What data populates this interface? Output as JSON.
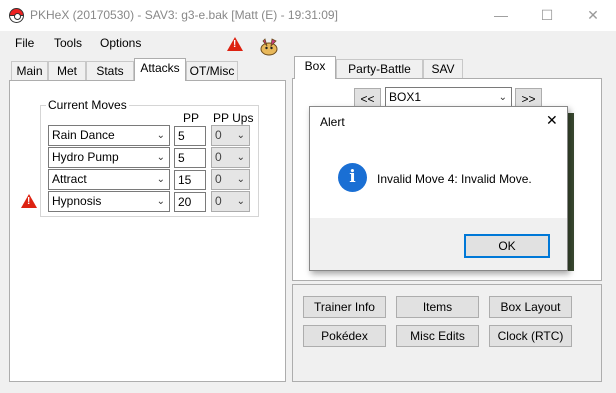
{
  "window": {
    "title": "PKHeX (20170530) - SAV3: g3-e.bak [Matt (E) - 19:31:09]",
    "controls": [
      "—",
      "☐",
      "✕"
    ]
  },
  "menu": [
    "File",
    "Tools",
    "Options"
  ],
  "left_tabs": [
    "Main",
    "Met",
    "Stats",
    "Attacks",
    "OT/Misc"
  ],
  "left_active_tab": "Attacks",
  "current_moves": {
    "title": "Current Moves",
    "pp_header": "PP",
    "ppups_header": "PP Ups",
    "moves": [
      {
        "name": "Rain Dance",
        "pp": "5",
        "ppups": "0"
      },
      {
        "name": "Hydro Pump",
        "pp": "5",
        "ppups": "0"
      },
      {
        "name": "Attract",
        "pp": "15",
        "ppups": "0"
      },
      {
        "name": "Hypnosis",
        "pp": "20",
        "ppups": "0"
      }
    ]
  },
  "right_tabs": [
    "Box",
    "Party-Battle Box",
    "SAV"
  ],
  "right_active_tab": "Box",
  "box": {
    "prev": "<<",
    "selected": "BOX1",
    "next": ">>"
  },
  "buttons": [
    "Trainer Info",
    "Items",
    "Box Layout",
    "Pokédex",
    "Misc Edits",
    "Clock (RTC)"
  ],
  "alert": {
    "title": "Alert",
    "close": "✕",
    "message": "Invalid Move 4: Invalid Move.",
    "ok": "OK",
    "info_glyph": "i"
  },
  "warning_glyph": "!",
  "colors": {
    "warning": "#dd2211",
    "info": "#1a6fd4",
    "focus": "#0078d7"
  }
}
